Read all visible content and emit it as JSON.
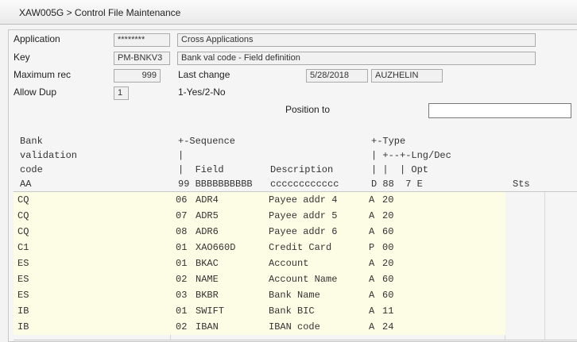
{
  "window": {
    "title": "XAW005G > Control File Maintenance"
  },
  "form": {
    "application_label": "Application",
    "application_value": "********",
    "application_desc": "Cross Applications",
    "key_label": "Key",
    "key_value": "PM-BNKV3",
    "key_desc": "Bank val code - Field definition",
    "maxrec_label": "Maximum rec",
    "maxrec_value": "999",
    "lastchange_label": "Last change",
    "lastchange_date": "5/28/2018",
    "lastchange_user": "AUZHELIN",
    "allowdup_label": "Allow Dup",
    "allowdup_value": "1",
    "allowdup_hint": "1-Yes/2-No",
    "position_label": "Position to",
    "position_value": ""
  },
  "header": {
    "col1": [
      "Bank",
      "validation",
      "code",
      "AA"
    ],
    "col2": [
      "+-Sequence",
      "|",
      "|  Field",
      "99 BBBBBBBBBB"
    ],
    "col3": [
      "",
      "",
      "Description",
      "cccccccccccc"
    ],
    "col4": [
      "+-Type",
      "| +--+-Lng/Dec",
      "| |  | Opt",
      "D 88  7 E"
    ],
    "sts": "Sts"
  },
  "rows": [
    {
      "code": "CQ",
      "seq": "06",
      "field": "ADR4",
      "desc": "Payee addr 4",
      "type": "A",
      "lng": "20"
    },
    {
      "code": "CQ",
      "seq": "07",
      "field": "ADR5",
      "desc": "Payee addr 5",
      "type": "A",
      "lng": "20"
    },
    {
      "code": "CQ",
      "seq": "08",
      "field": "ADR6",
      "desc": "Payee addr 6",
      "type": "A",
      "lng": "60"
    },
    {
      "code": "C1",
      "seq": "01",
      "field": "XAO660D",
      "desc": "Credit Card",
      "type": "P",
      "lng": "00"
    },
    {
      "code": "ES",
      "seq": "01",
      "field": "BKAC",
      "desc": "Account",
      "type": "A",
      "lng": "20"
    },
    {
      "code": "ES",
      "seq": "02",
      "field": "NAME",
      "desc": "Account Name",
      "type": "A",
      "lng": "60"
    },
    {
      "code": "ES",
      "seq": "03",
      "field": "BKBR",
      "desc": "Bank Name",
      "type": "A",
      "lng": "60"
    },
    {
      "code": "IB",
      "seq": "01",
      "field": "SWIFT",
      "desc": "Bank BIC",
      "type": "A",
      "lng": "11"
    },
    {
      "code": "IB",
      "seq": "02",
      "field": "IBAN",
      "desc": "IBAN code",
      "type": "A",
      "lng": "24"
    }
  ]
}
